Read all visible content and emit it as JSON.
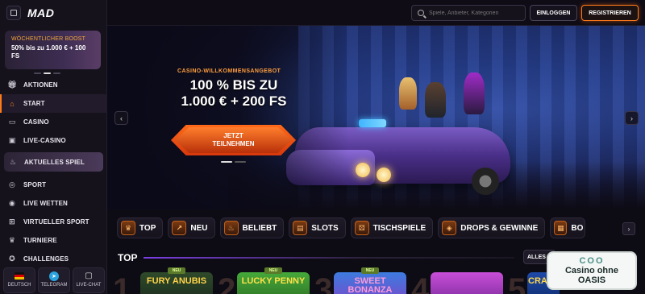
{
  "brand": {
    "logo": "MAD"
  },
  "sidebar": {
    "promo": {
      "kicker": "WÖCHENTLICHER BOOST",
      "value": "50% bis zu 1.000 € + 100 FS"
    },
    "items": [
      {
        "label": "AKTIONEN",
        "icon": "gift-icon"
      },
      {
        "label": "START",
        "icon": "home-icon"
      },
      {
        "label": "CASINO",
        "icon": "casino-icon"
      },
      {
        "label": "LIVE-CASINO",
        "icon": "live-casino-icon"
      },
      {
        "label": "AKTUELLES SPIEL",
        "icon": "flame-icon"
      },
      {
        "label": "SPORT",
        "icon": "ball-icon"
      },
      {
        "label": "LIVE WETTEN",
        "icon": "live-bet-icon"
      },
      {
        "label": "VIRTUELLER SPORT",
        "icon": "gamepad-icon"
      },
      {
        "label": "TURNIERE",
        "icon": "trophy-icon"
      },
      {
        "label": "CHALLENGES",
        "icon": "medal-icon"
      }
    ],
    "bottom": [
      {
        "label": "DEUTSCH",
        "icon": "german-flag-icon"
      },
      {
        "label": "TELEGRAM",
        "icon": "telegram-icon"
      },
      {
        "label": "LIVE-CHAT",
        "icon": "chat-icon"
      }
    ]
  },
  "header": {
    "search_placeholder": "Spiele, Anbieter, Kategorien",
    "login_label": "EINLOGGEN",
    "register_label": "REGISTRIEREN"
  },
  "hero": {
    "kicker": "CASINO-WILLKOMMENSANGEBOT",
    "title_line1": "100 % BIS ZU",
    "title_line2": "1.000 € + 200 FS",
    "cta_label": "JETZT TEILNEHMEN",
    "prev": "‹",
    "next": "›"
  },
  "categories": [
    {
      "label": "TOP",
      "icon": "crown-icon"
    },
    {
      "label": "NEU",
      "icon": "new-icon"
    },
    {
      "label": "BELIEBT",
      "icon": "fire-icon"
    },
    {
      "label": "SLOTS",
      "icon": "slot-icon"
    },
    {
      "label": "TISCHSPIELE",
      "icon": "dice-icon"
    },
    {
      "label": "DROPS & GEWINNE",
      "icon": "drops-icon"
    },
    {
      "label": "BO",
      "icon": "bonus-icon"
    }
  ],
  "top_section": {
    "title": "TOP",
    "all_label": "ALLES A",
    "games": [
      {
        "rank": "1",
        "name": "FURY ANUBIS",
        "badge": "NEU"
      },
      {
        "rank": "2",
        "name": "LUCKY PENNY",
        "badge": "NEU"
      },
      {
        "rank": "3",
        "name": "SWEET BONANZA",
        "badge": "NEU"
      },
      {
        "rank": "4",
        "name": "",
        "badge": ""
      },
      {
        "rank": "5",
        "name": "CRAZY",
        "badge": ""
      }
    ]
  },
  "overlay": {
    "line1": "COO",
    "line2": "Casino ohne",
    "line3": "OASIS"
  },
  "colors": {
    "accent": "#ff7a1a",
    "background": "#0d0b14",
    "sidebar": "#15121c"
  }
}
